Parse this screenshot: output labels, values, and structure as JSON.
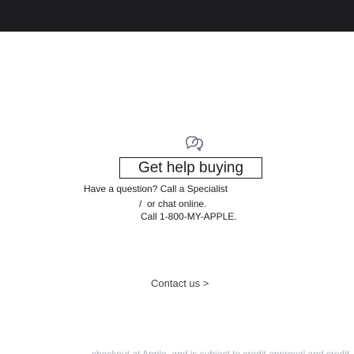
{
  "help_section": {
    "icon": "chat-bubbles-icon",
    "title": "Get help buying",
    "text_line_1": "Have a question? Call a Specialist",
    "text_line_2": "or chat online.",
    "text_line_3": "Call 1-800-MY-APPLE.",
    "contact_link": "Contact us >"
  },
  "footer": {
    "partial_text": "checkout at Apple, and is subject to credit approval and credit limit."
  },
  "colors": {
    "dark_bar": "#1d1d1f",
    "text": "#1d1d1f",
    "link": "#3f3f46"
  }
}
